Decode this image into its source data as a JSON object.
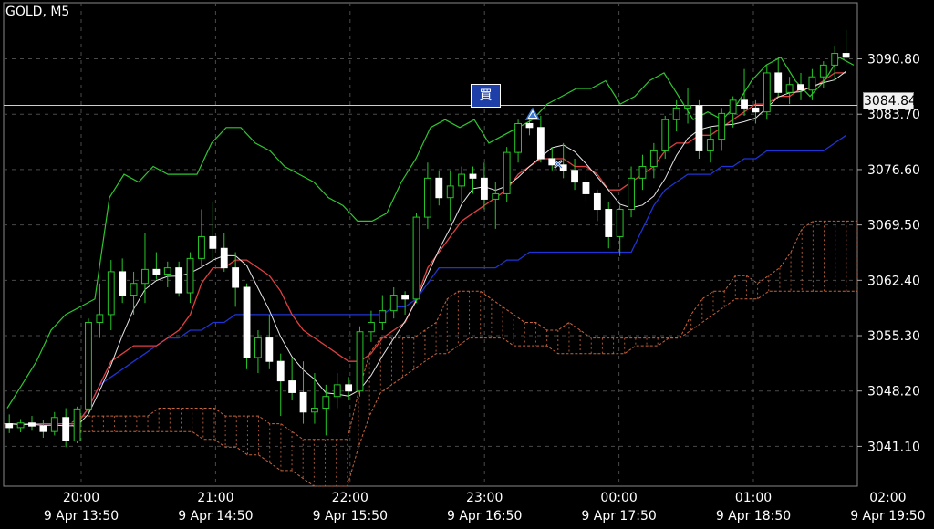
{
  "symbol": "GOLD, M5",
  "current_price": "3084.84",
  "buy_marker_label": "買",
  "price_scale": [
    "3090.80",
    "3083.70",
    "3076.60",
    "3069.50",
    "3062.40",
    "3055.30",
    "3048.20",
    "3041.10"
  ],
  "time_major_labels": [
    "20:00",
    "21:00",
    "22:00",
    "23:00",
    "00:00",
    "01:00",
    "02:00"
  ],
  "time_minor_labels": [
    "9 Apr 13:50",
    "9 Apr 14:50",
    "9 Apr 15:50",
    "9 Apr 16:50",
    "9 Apr 17:50",
    "9 Apr 18:50",
    "9 Apr 19:50"
  ],
  "colors": {
    "background": "#000000",
    "grid": "#4a4a4a",
    "bull_candle": "#ffffff",
    "bear_candle": "#ffffff",
    "wick": "#27c627",
    "tenkan": "#e04040",
    "kijun": "#1e34d6",
    "chikou": "#2ec82e",
    "span_a_b": "#c8643c",
    "price_line": "#cccccc"
  },
  "chart_data": {
    "type": "candlestick",
    "title": "GOLD, M5",
    "y_range": [
      3036,
      3098
    ],
    "candles": [
      [
        3044.0,
        3045.2,
        3042.8,
        3043.5
      ],
      [
        3043.5,
        3044.6,
        3042.9,
        3044.1
      ],
      [
        3044.1,
        3045.0,
        3043.1,
        3043.7
      ],
      [
        3043.7,
        3044.5,
        3042.2,
        3043.0
      ],
      [
        3043.0,
        3045.5,
        3042.5,
        3044.8
      ],
      [
        3044.8,
        3046.0,
        3041.0,
        3041.8
      ],
      [
        3041.8,
        3046.2,
        3041.5,
        3045.9
      ],
      [
        3045.9,
        3057.5,
        3045.5,
        3057.0
      ],
      [
        3057.0,
        3062.0,
        3055.0,
        3058.0
      ],
      [
        3058.0,
        3065.0,
        3056.0,
        3063.5
      ],
      [
        3063.5,
        3065.2,
        3059.5,
        3060.5
      ],
      [
        3060.5,
        3063.5,
        3058.0,
        3062.0
      ],
      [
        3062.0,
        3068.5,
        3059.5,
        3063.8
      ],
      [
        3063.8,
        3066.0,
        3062.5,
        3063.2
      ],
      [
        3063.2,
        3064.8,
        3061.5,
        3064.0
      ],
      [
        3064.0,
        3064.8,
        3060.3,
        3060.8
      ],
      [
        3060.8,
        3066.0,
        3059.5,
        3065.2
      ],
      [
        3065.2,
        3071.5,
        3064.0,
        3068.0
      ],
      [
        3068.0,
        3072.5,
        3065.0,
        3066.5
      ],
      [
        3066.5,
        3068.5,
        3063.5,
        3064.0
      ],
      [
        3064.0,
        3066.0,
        3059.0,
        3061.5
      ],
      [
        3061.5,
        3062.0,
        3051.0,
        3052.5
      ],
      [
        3052.5,
        3056.0,
        3050.5,
        3055.0
      ],
      [
        3055.0,
        3058.0,
        3051.0,
        3052.0
      ],
      [
        3052.0,
        3053.0,
        3045.0,
        3049.5
      ],
      [
        3049.5,
        3052.5,
        3047.0,
        3048.0
      ],
      [
        3048.0,
        3052.0,
        3044.0,
        3045.5
      ],
      [
        3045.5,
        3050.5,
        3044.0,
        3046.0
      ],
      [
        3046.0,
        3049.0,
        3042.5,
        3047.5
      ],
      [
        3047.5,
        3050.5,
        3046.0,
        3049.0
      ],
      [
        3049.0,
        3050.0,
        3047.0,
        3048.2
      ],
      [
        3048.2,
        3056.5,
        3047.5,
        3055.8
      ],
      [
        3055.8,
        3058.5,
        3054.5,
        3057.0
      ],
      [
        3057.0,
        3060.5,
        3056.0,
        3058.5
      ],
      [
        3058.5,
        3061.5,
        3057.5,
        3060.5
      ],
      [
        3060.5,
        3061.0,
        3058.0,
        3060.0
      ],
      [
        3060.0,
        3071.0,
        3059.5,
        3070.5
      ],
      [
        3070.5,
        3077.5,
        3069.0,
        3075.5
      ],
      [
        3075.5,
        3076.5,
        3072.0,
        3073.0
      ],
      [
        3073.0,
        3076.5,
        3070.0,
        3074.5
      ],
      [
        3074.5,
        3077.0,
        3072.5,
        3076.0
      ],
      [
        3076.0,
        3077.0,
        3073.5,
        3075.5
      ],
      [
        3075.5,
        3077.5,
        3071.5,
        3072.8
      ],
      [
        3072.8,
        3075.0,
        3069.0,
        3073.5
      ],
      [
        3073.5,
        3079.5,
        3072.5,
        3078.8
      ],
      [
        3078.8,
        3083.0,
        3077.5,
        3082.5
      ],
      [
        3082.5,
        3083.5,
        3081.0,
        3082.0
      ],
      [
        3082.0,
        3083.5,
        3077.5,
        3078.0
      ],
      [
        3078.0,
        3079.5,
        3076.5,
        3077.2
      ],
      [
        3077.2,
        3080.0,
        3075.5,
        3076.5
      ],
      [
        3076.5,
        3078.0,
        3074.0,
        3075.0
      ],
      [
        3075.0,
        3076.5,
        3072.5,
        3073.5
      ],
      [
        3073.5,
        3074.0,
        3070.0,
        3071.5
      ],
      [
        3071.5,
        3072.5,
        3066.5,
        3068.0
      ],
      [
        3068.0,
        3072.0,
        3065.5,
        3071.5
      ],
      [
        3071.5,
        3077.0,
        3070.5,
        3075.5
      ],
      [
        3075.5,
        3078.5,
        3074.0,
        3077.0
      ],
      [
        3077.0,
        3080.0,
        3075.5,
        3079.0
      ],
      [
        3079.0,
        3083.5,
        3078.0,
        3083.0
      ],
      [
        3083.0,
        3085.5,
        3081.5,
        3084.5
      ],
      [
        3084.5,
        3087.0,
        3082.5,
        3084.8
      ],
      [
        3084.8,
        3085.5,
        3078.0,
        3079.0
      ],
      [
        3079.0,
        3082.0,
        3077.5,
        3080.5
      ],
      [
        3080.5,
        3084.5,
        3079.0,
        3083.8
      ],
      [
        3083.8,
        3086.0,
        3082.0,
        3085.5
      ],
      [
        3085.5,
        3089.5,
        3083.5,
        3084.5
      ],
      [
        3084.5,
        3085.5,
        3082.5,
        3084.0
      ],
      [
        3084.0,
        3090.0,
        3083.0,
        3089.0
      ],
      [
        3089.0,
        3091.0,
        3086.0,
        3086.5
      ],
      [
        3086.5,
        3088.5,
        3085.0,
        3087.5
      ],
      [
        3087.5,
        3089.0,
        3085.5,
        3086.8
      ],
      [
        3086.8,
        3089.5,
        3085.5,
        3088.5
      ],
      [
        3088.5,
        3090.5,
        3087.0,
        3090.0
      ],
      [
        3090.0,
        3092.5,
        3088.0,
        3091.5
      ],
      [
        3091.5,
        3094.5,
        3090.0,
        3091.0
      ]
    ],
    "tenkan": [
      3044,
      3044,
      3044,
      3044,
      3044,
      3044,
      3044,
      3046,
      3049,
      3052,
      3053,
      3054,
      3054,
      3054,
      3055,
      3056,
      3058,
      3062,
      3064,
      3064,
      3065,
      3065,
      3064,
      3063,
      3061,
      3058,
      3056,
      3055,
      3054,
      3053,
      3052,
      3052,
      3053,
      3055,
      3056,
      3057,
      3060,
      3064,
      3066,
      3068,
      3070,
      3071,
      3072,
      3073,
      3074,
      3076,
      3077,
      3078,
      3078,
      3078,
      3077,
      3077,
      3076,
      3074,
      3074,
      3075,
      3076,
      3077,
      3079,
      3080,
      3080,
      3081,
      3081,
      3082,
      3083,
      3084,
      3085,
      3085,
      3086,
      3086,
      3087,
      3087,
      3088,
      3089,
      3089
    ],
    "kijun": [
      3044,
      3044,
      3044,
      3044,
      3044,
      3044,
      3044,
      3046,
      3049,
      3050,
      3051,
      3052,
      3053,
      3054,
      3055,
      3055,
      3056,
      3056,
      3057,
      3057,
      3058,
      3058,
      3058,
      3058,
      3058,
      3058,
      3058,
      3058,
      3058,
      3058,
      3058,
      3058,
      3058,
      3058,
      3059,
      3059,
      3060,
      3062,
      3064,
      3064,
      3064,
      3064,
      3064,
      3064,
      3065,
      3065,
      3066,
      3066,
      3066,
      3066,
      3066,
      3066,
      3066,
      3066,
      3066,
      3066,
      3069,
      3072,
      3074,
      3075,
      3076,
      3076,
      3076,
      3077,
      3077,
      3078,
      3078,
      3079,
      3079,
      3079,
      3079,
      3079,
      3079,
      3080,
      3081
    ],
    "chikou": [
      3046,
      3049,
      3052,
      3056,
      3058,
      3059,
      3060,
      3073,
      3076,
      3075,
      3077,
      3076,
      3076,
      3076,
      3080,
      3082,
      3082,
      3080,
      3079,
      3077,
      3076,
      3075,
      3073,
      3072,
      3070,
      3070,
      3071,
      3075,
      3078,
      3082,
      3083,
      3082,
      3083,
      3080,
      3081,
      3082,
      3083,
      3085,
      3086,
      3087,
      3087,
      3088,
      3085,
      3086,
      3088,
      3089,
      3086,
      3083,
      3084,
      3083,
      3085,
      3088,
      3090,
      3091,
      3088,
      3086,
      3088,
      3091,
      3090
    ],
    "span_a": [
      3044,
      3044,
      3044,
      3044,
      3044,
      3044,
      3044,
      3045,
      3045,
      3045,
      3045,
      3045,
      3045,
      3045,
      3046,
      3046,
      3046,
      3046,
      3046,
      3046,
      3045,
      3045,
      3045,
      3045,
      3044,
      3044,
      3043,
      3042,
      3042,
      3042,
      3042,
      3042,
      3048,
      3053,
      3055,
      3055,
      3055,
      3055,
      3056,
      3057,
      3060,
      3061,
      3061,
      3061,
      3060,
      3059,
      3058,
      3057,
      3057,
      3056,
      3056,
      3057,
      3056,
      3055,
      3055,
      3055,
      3055,
      3055,
      3055,
      3055,
      3055,
      3055,
      3058,
      3060,
      3061,
      3061,
      3063,
      3063,
      3062,
      3063,
      3064,
      3066,
      3069,
      3070,
      3070,
      3070,
      3070,
      3070
    ],
    "span_b": [
      3044,
      3044,
      3044,
      3044,
      3044,
      3044,
      3044,
      3043,
      3043,
      3043,
      3043,
      3043,
      3043,
      3043,
      3043,
      3043,
      3043,
      3043,
      3042,
      3042,
      3041,
      3041,
      3040,
      3040,
      3039,
      3038,
      3038,
      3037,
      3036,
      3036,
      3036,
      3036,
      3041,
      3045,
      3048,
      3049,
      3050,
      3051,
      3052,
      3053,
      3053,
      3054,
      3055,
      3055,
      3055,
      3055,
      3054,
      3054,
      3054,
      3054,
      3053,
      3053,
      3053,
      3053,
      3053,
      3053,
      3053,
      3054,
      3054,
      3054,
      3055,
      3055,
      3056,
      3057,
      3058,
      3059,
      3060,
      3060,
      3060,
      3061,
      3061,
      3061,
      3061,
      3061,
      3061,
      3061,
      3061,
      3061
    ],
    "markers": [
      {
        "label": "買",
        "type": "buy",
        "price": 3086.0
      },
      {
        "type": "triangle",
        "price": 3083.0
      },
      {
        "type": "cross",
        "price": 3076.8
      }
    ]
  }
}
